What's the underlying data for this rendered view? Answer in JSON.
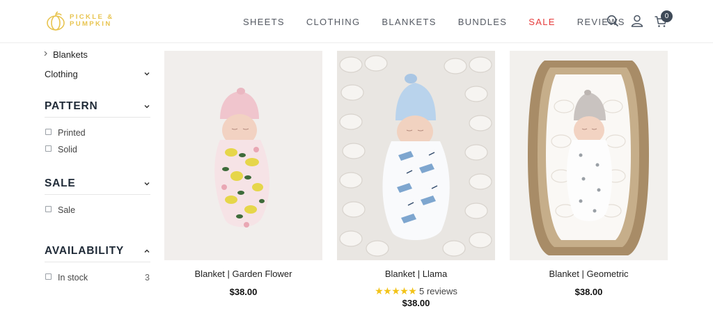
{
  "brand": {
    "logo_line1": "PICKLE &",
    "logo_line2": "PUMPKIN",
    "accent": "#e8c44f"
  },
  "nav": {
    "items": [
      {
        "label": "SHEETS"
      },
      {
        "label": "CLOTHING"
      },
      {
        "label": "BLANKETS"
      },
      {
        "label": "BUNDLES"
      },
      {
        "label": "SALE",
        "highlight": "#e63c3c"
      },
      {
        "label": "REVIEWS"
      }
    ],
    "icons": [
      "search-icon",
      "account-icon",
      "cart-icon"
    ],
    "cart_count": "0"
  },
  "sidebar": {
    "categories": [
      {
        "label": "Blankets",
        "icon": "chevron-right-icon"
      },
      {
        "label": "Clothing",
        "icon": "chevron-down-icon"
      }
    ],
    "sections": [
      {
        "title": "PATTERN",
        "expanded": true,
        "options": [
          {
            "label": "Printed"
          },
          {
            "label": "Solid"
          }
        ]
      },
      {
        "title": "SALE",
        "expanded": true,
        "options": [
          {
            "label": "Sale"
          }
        ]
      },
      {
        "title": "AVAILABILITY",
        "expanded": true,
        "options": [
          {
            "label": "In stock",
            "count": "3"
          }
        ]
      }
    ]
  },
  "products": [
    {
      "name": "Blanket | Garden Flower",
      "price": "$38.00"
    },
    {
      "name": "Blanket | Llama",
      "rating": 5,
      "reviews_label": "5 reviews",
      "price": "$38.00"
    },
    {
      "name": "Blanket | Geometric",
      "price": "$38.00"
    }
  ]
}
